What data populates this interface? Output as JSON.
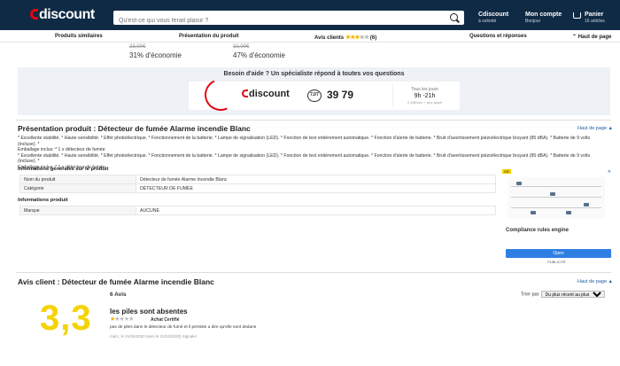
{
  "header": {
    "logo": "discount",
    "search_placeholder": "Qu'est-ce qui vous ferait plaisir ?",
    "cdiscount_label": "Cdiscount",
    "cdiscount_sub": "à volonté",
    "account_label": "Mon compte",
    "account_sub": "Bonjour",
    "cart_label": "Panier",
    "cart_sub": "16 articles"
  },
  "nav": {
    "similar": "Produits similaires",
    "presentation": "Présentation du produit",
    "reviews": "Avis clients",
    "review_count": "(6)",
    "questions": "Questions et réponses",
    "top": "Haut de page"
  },
  "economy": {
    "item1_old": "23,00€",
    "item1_pct": "31% d'économie",
    "item2_old": "32,00€",
    "item2_pct": "47% d'économie"
  },
  "help": {
    "title": "Besoin d'aide ? Un spécialiste répond à toutes vos questions",
    "brand": "discount",
    "hours_badge": "7J/7",
    "phone": "39 79",
    "open_label": "Tous les jours",
    "open_hours": "9h -21h",
    "price_note": "0,15€/min + prix appel"
  },
  "presentation": {
    "title": "Présentation produit : Détecteur de fumée Alarme incendie Blanc",
    "top_link": "Haut de page ▲",
    "desc1": "* Excellente stabilité. * Haute sensibilité. * Effet photoélectrique. * Fonctionnement de la batterie. * Lampe de signalisation (LED). * Fonction de test entièrement automatique. * Fonction d'alerte de batterie. * Bruit d'avertissement piézoélectrique bruyant (85 dBA). * Batterie de 9 volts (incluse). *",
    "desc2": "Emballage inclus: * 1 x détecteur de fumée",
    "desc3": "* Excellente stabilité. * Haute sensibilité. * Effet photoélectrique. * Fonctionnement de la batterie. * Lampe de signalisation (LED). * Fonction de test entièrement automatique. * Fonction d'alerte de batterie. * Bruit d'avertissement piézoélectrique bruyant (85 dBA). * Batterie de 9 volts (incluse). *",
    "desc4": "Emballage inclus: * 1 x détecteur de fumée"
  },
  "info": {
    "general_title": "Informations générales sur le produit",
    "rows_general": [
      {
        "label": "Nom du produit",
        "value": "Détecteur de fumée Alarme incendie Blanc"
      },
      {
        "label": "Catégorie",
        "value": "DÉTECTEUR DE FUMÉE"
      }
    ],
    "product_title": "Informations produit",
    "rows_product": [
      {
        "label": "Marque",
        "value": "AUCUNE"
      }
    ]
  },
  "ad": {
    "tag": "Ad",
    "close": "✕",
    "title": "Compliance rules engine",
    "button": "Open",
    "publicity": "PUBLICITÉ"
  },
  "reviews": {
    "title": "Avis client : Détecteur de fumée Alarme incendie Blanc",
    "top_link": "Haut de page ▲",
    "score": "3,3",
    "count": "6 Avis",
    "sort_label": "Trier par",
    "sort_value": "Du plus récent au plus ancien",
    "first_title": "les piles sont absentes",
    "first_badge": "Achat Certifié",
    "first_body": "pas de piles dans le détecteur de fumé et il persiste a dire qu'elle sont dedans",
    "first_date": "marc, le 21/04/2020 (avis le 21/04/2020)   Signaler"
  },
  "colors": {
    "header": "#0f2a44",
    "accent": "#e30613",
    "star": "#f5b800",
    "link": "#1b5fa8"
  }
}
